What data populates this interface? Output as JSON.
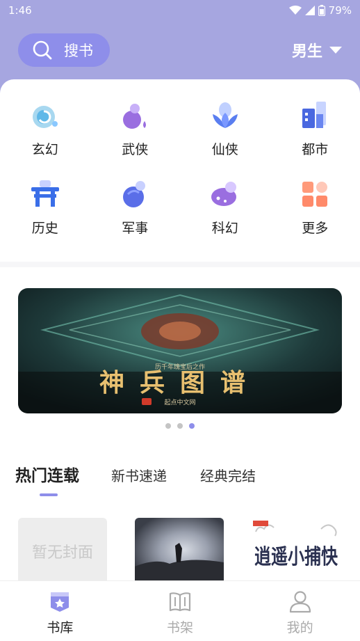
{
  "status_bar": {
    "time": "1:46",
    "battery": "79%"
  },
  "header": {
    "search_label": "搜书",
    "gender_label": "男生",
    "search_icon": "search-icon",
    "dropdown_icon": "caret-down-icon"
  },
  "categories": [
    {
      "label": "玄幻",
      "icon": "swirl-icon"
    },
    {
      "label": "武侠",
      "icon": "gourd-icon"
    },
    {
      "label": "仙侠",
      "icon": "lotus-icon"
    },
    {
      "label": "都市",
      "icon": "buildings-icon"
    },
    {
      "label": "历史",
      "icon": "gate-icon"
    },
    {
      "label": "军事",
      "icon": "grenade-icon"
    },
    {
      "label": "科幻",
      "icon": "planet-icon"
    },
    {
      "label": "更多",
      "icon": "grid-icon"
    }
  ],
  "banner": {
    "title": "神兵图谱",
    "subtitle": "历千年瑰宝后之作",
    "publisher": "起点中文网"
  },
  "carousel": {
    "count": 3,
    "active_index": 2
  },
  "tabs": [
    "热门连载",
    "新书速递",
    "经典完结"
  ],
  "active_tab": 0,
  "books": [
    {
      "cover_text": "暂无封面",
      "placeholder": true
    },
    {
      "cover_text": "",
      "placeholder": false
    },
    {
      "cover_text": "逍遥小捕快",
      "placeholder": false
    }
  ],
  "bottom_nav": [
    {
      "label": "书库",
      "icon": "bookstore-icon",
      "active": true
    },
    {
      "label": "书架",
      "icon": "bookshelf-icon",
      "active": false
    },
    {
      "label": "我的",
      "icon": "profile-icon",
      "active": false
    }
  ],
  "colors": {
    "header_bg": "#a6a6e0",
    "accent": "#8e8eea",
    "text": "#222222",
    "muted": "#aaaaaa"
  }
}
